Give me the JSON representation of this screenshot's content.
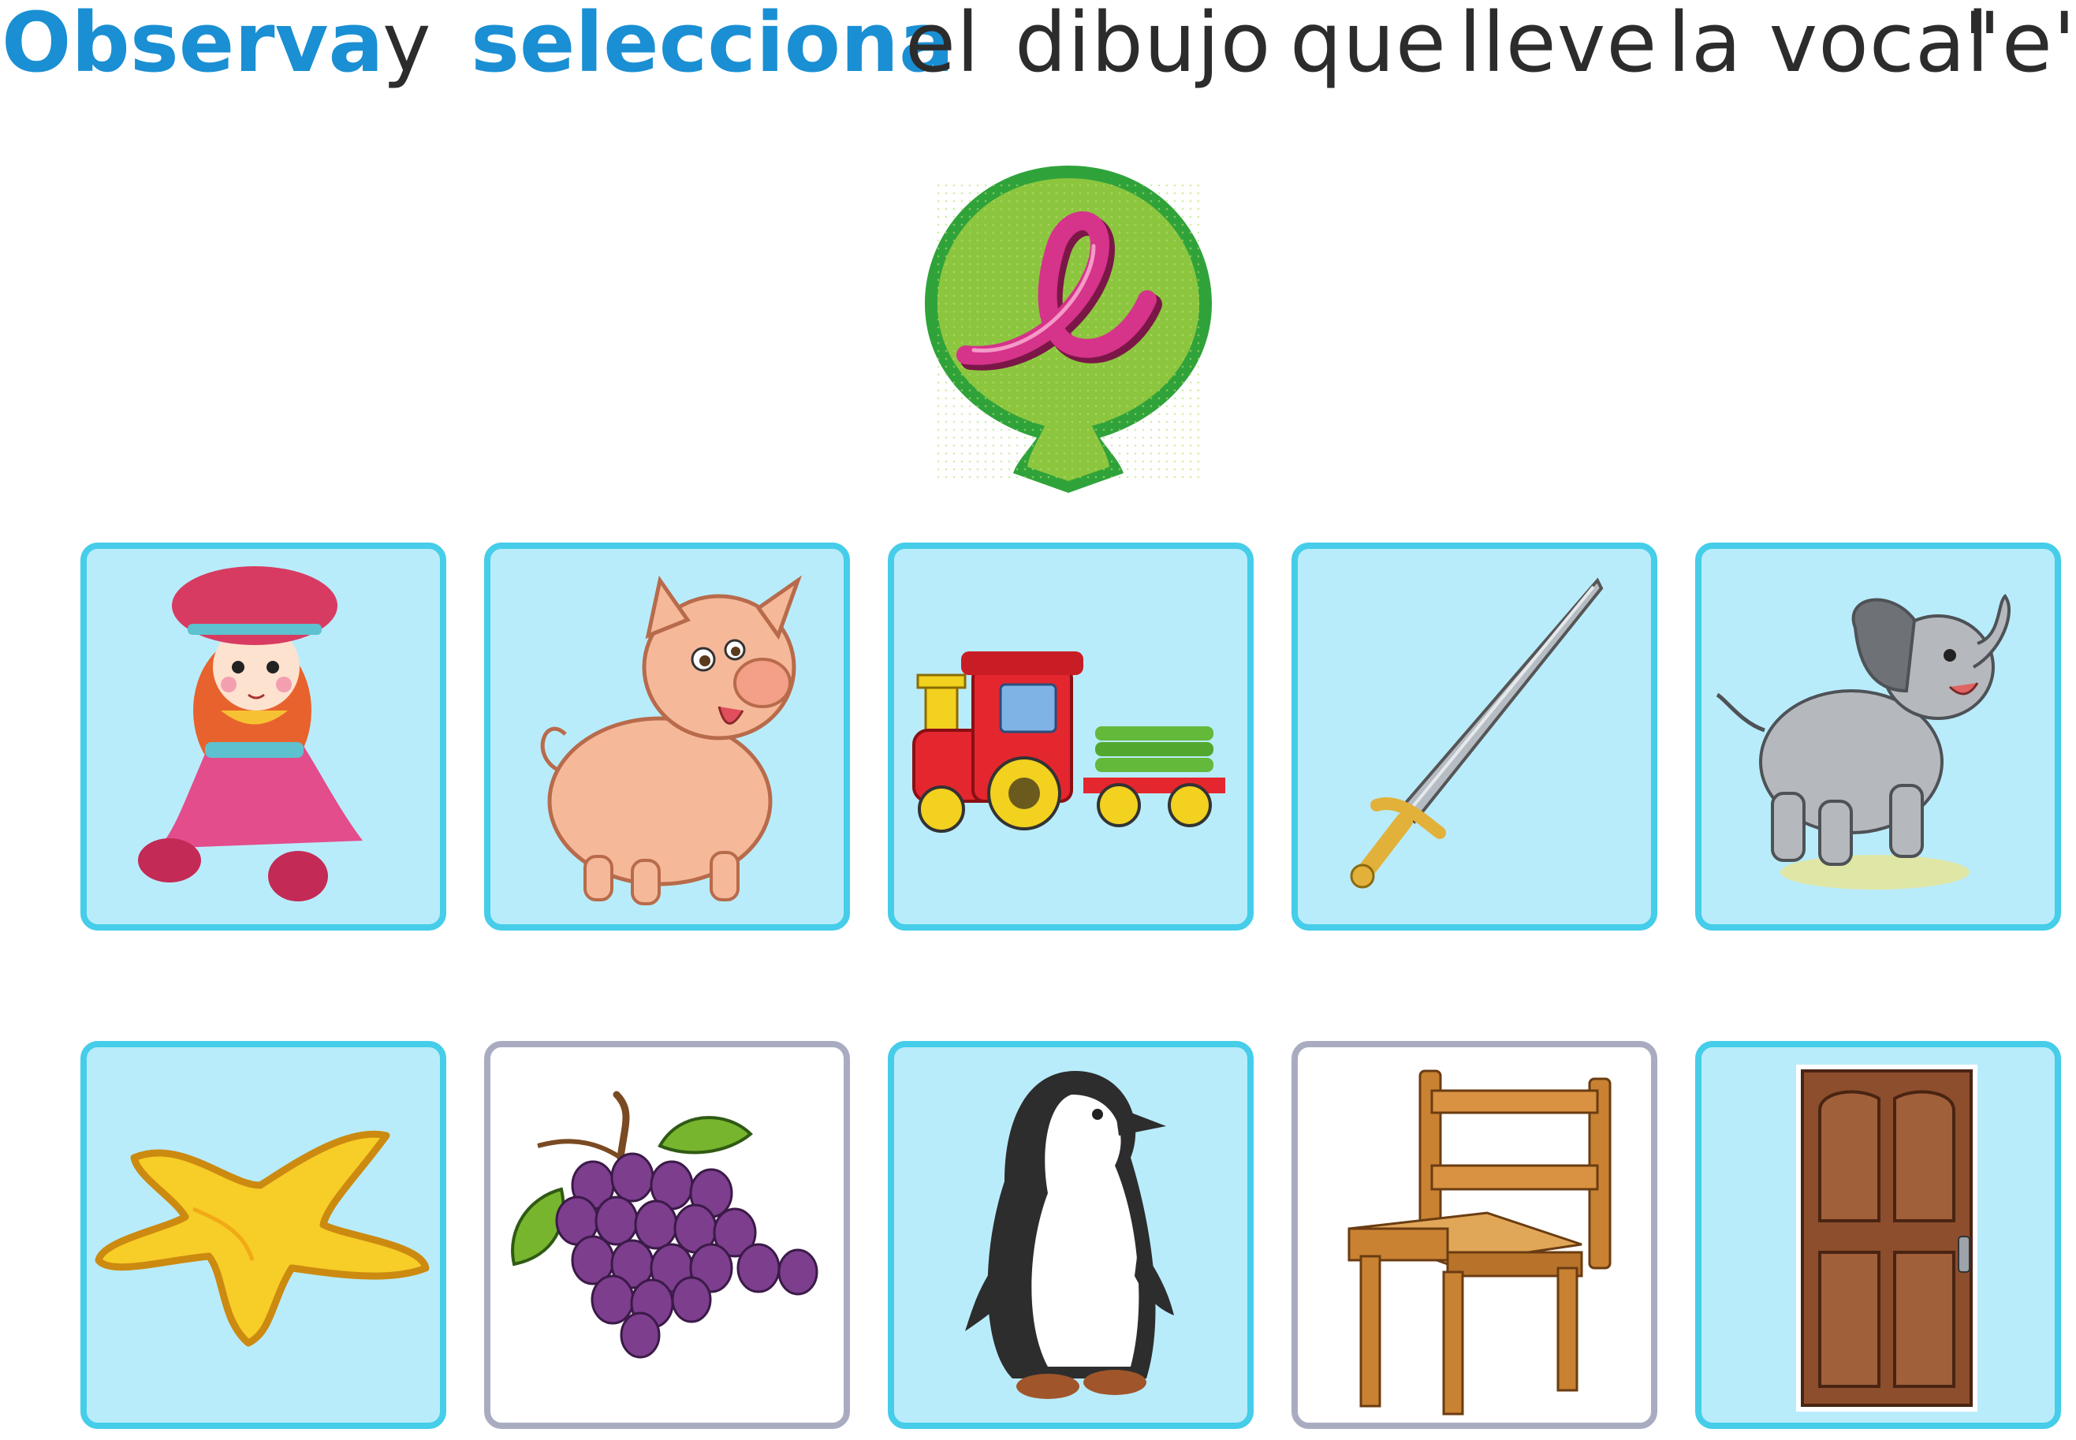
{
  "instruction": {
    "observa": "Observa",
    "y": "y",
    "selecciona": "selecciona",
    "el": "el",
    "dibujo": "dibujo",
    "que": "que",
    "lleve": "lleve",
    "la_vocal": "la vocal",
    "letra": "\"e\"."
  },
  "balloon": {
    "letter": "e",
    "letter_color": "#d6338a",
    "balloon_color": "#8cc63f"
  },
  "colors": {
    "card_bg": "#b9ecfb",
    "card_border": "#45cde9",
    "card_bg_alt": "#ffffff",
    "card_border_alt": "#a9acc1",
    "accent_text": "#1a8fd3"
  },
  "cards": [
    {
      "icon": "doll-icon"
    },
    {
      "icon": "pig-icon"
    },
    {
      "icon": "train-icon"
    },
    {
      "icon": "sword-icon"
    },
    {
      "icon": "elephant-icon"
    },
    {
      "icon": "star-icon"
    },
    {
      "icon": "grapes-icon"
    },
    {
      "icon": "penguin-icon"
    },
    {
      "icon": "chair-icon"
    },
    {
      "icon": "door-icon"
    }
  ]
}
